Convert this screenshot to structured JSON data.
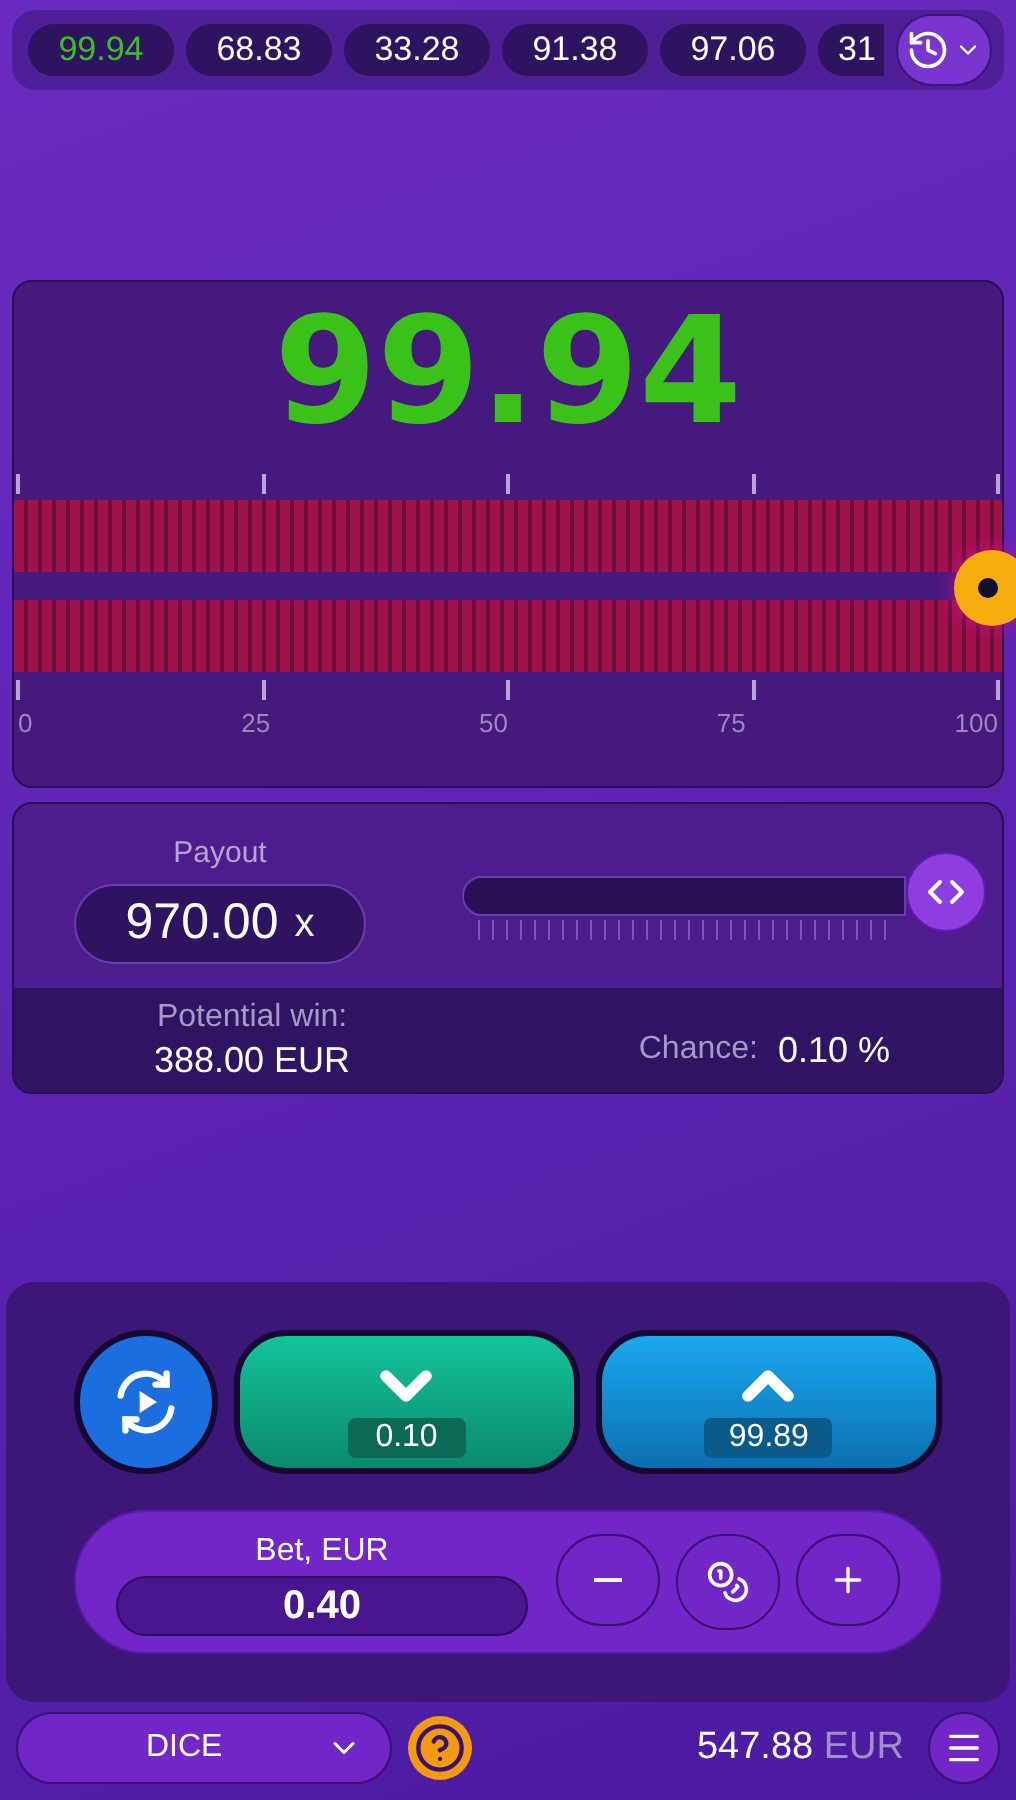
{
  "history": [
    {
      "value": "99.94",
      "win": true
    },
    {
      "value": "68.83",
      "win": false
    },
    {
      "value": "33.28",
      "win": false
    },
    {
      "value": "91.38",
      "win": false
    },
    {
      "value": "97.06",
      "win": false
    },
    {
      "value": "31",
      "win": false
    }
  ],
  "result": {
    "value": "99.94",
    "scale": [
      "0",
      "25",
      "50",
      "75",
      "100"
    ]
  },
  "payout": {
    "label": "Payout",
    "value": "970.00",
    "unit": "x"
  },
  "potential_win": {
    "label": "Potential win:",
    "value": "388.00 EUR"
  },
  "chance": {
    "label": "Chance:",
    "value": "0.10 %"
  },
  "under_button": {
    "value": "0.10"
  },
  "over_button": {
    "value": "99.89"
  },
  "bet": {
    "label": "Bet, EUR",
    "value": "0.40"
  },
  "footer": {
    "game": "DICE",
    "balance": "547.88",
    "currency": "EUR"
  }
}
